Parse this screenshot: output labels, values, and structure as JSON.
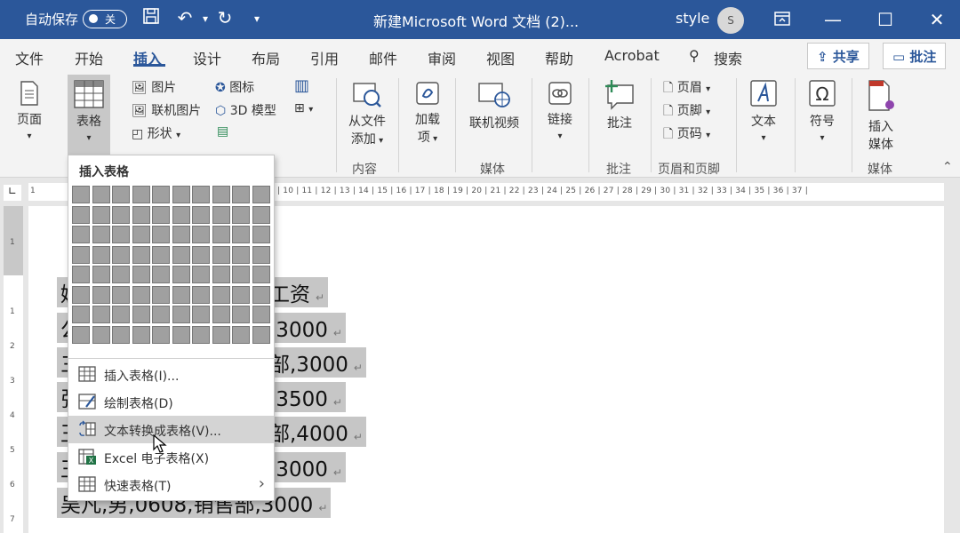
{
  "titlebar": {
    "autosave_label": "自动保存",
    "autosave_state": "关",
    "document_title": "新建Microsoft Word 文档 (2)...",
    "user_name": "style",
    "avatar_initial": "S",
    "bg_color": "#2b579a"
  },
  "tabs": [
    {
      "label": "文件"
    },
    {
      "label": "开始"
    },
    {
      "label": "插入"
    },
    {
      "label": "设计"
    },
    {
      "label": "布局"
    },
    {
      "label": "引用"
    },
    {
      "label": "邮件"
    },
    {
      "label": "审阅"
    },
    {
      "label": "视图"
    },
    {
      "label": "帮助"
    },
    {
      "label": "Acrobat"
    }
  ],
  "active_tab": "插入",
  "search": {
    "label": "搜索"
  },
  "share_button": "共享",
  "comment_button": "批注",
  "ribbon": {
    "page": "页面",
    "table": "表格",
    "picture": "图片",
    "online_picture": "联机图片",
    "shapes": "形状",
    "icons": "图标",
    "model3d": "3D 模型",
    "from_file_l1": "从文件",
    "from_file_l2": "添加",
    "addins_l1": "加载",
    "addins_l2": "项",
    "online_video": "联机视频",
    "link": "链接",
    "comment": "批注",
    "header": "页眉",
    "footer": "页脚",
    "page_number": "页码",
    "text": "文本",
    "symbol": "符号",
    "insert_media_l1": "插入",
    "insert_media_l2": "媒体",
    "group_content": "内容",
    "group_media": "媒体",
    "group_comment": "批注",
    "group_header_footer": "页眉和页脚",
    "group_media2": "媒体"
  },
  "ruler_numbers": "| 10 | 11 | 12 | 13 | 14 | 15 | 16 | 17 | 18 | 19 | 20 | 21 | 22 | 23 | 24 | 25 | 26 | 27 | 28 | 29 | 30 | 31 | 32 | 33 | 34 | 35 | 36 | 37 |",
  "ruler_left": "1",
  "vruler_numbers": [
    "1",
    "1",
    "2",
    "3",
    "4",
    "5",
    "6",
    "7"
  ],
  "document_lines": [
    {
      "text": "姓名,性别,工号,部门,工资"
    },
    {
      "text": "公,男,0601,财务部,3000"
    },
    {
      "text": "三,女,0602,行政部,3000"
    },
    {
      "text": "张,男,0603,人事部,3500"
    },
    {
      "text": "王,男,0604,市场部,4000"
    },
    {
      "text": "王,女,0607,销售部,3000"
    },
    {
      "text": "吴凡,男,0608,销售部,3000"
    }
  ],
  "document_visible_fragments": [
    {
      "text": "娃",
      "tail": "工资"
    },
    {
      "text": "公",
      "tail": ",3000"
    },
    {
      "text": "三",
      "tail": "部,3000"
    },
    {
      "text": "张",
      "tail": ",3500"
    },
    {
      "text": "王",
      "tail": "部,4000"
    },
    {
      "text": "王",
      "tail": ",3000"
    },
    {
      "text": "吴凡,男,0608,销售部,3000",
      "tail": ""
    }
  ],
  "paragraph_mark": "↵",
  "dropdown": {
    "title": "插入表格",
    "grid_rows": 8,
    "grid_cols": 10,
    "items": [
      {
        "label": "插入表格(I)...",
        "icon": "table-grid-icon"
      },
      {
        "label": "绘制表格(D)",
        "icon": "draw-table-icon"
      },
      {
        "label": "文本转换成表格(V)...",
        "icon": "convert-text-table-icon",
        "highlighted": true
      },
      {
        "label": "Excel 电子表格(X)",
        "icon": "excel-sheet-icon"
      },
      {
        "label": "快速表格(T)",
        "icon": "quick-table-icon",
        "has_submenu": true
      }
    ]
  }
}
